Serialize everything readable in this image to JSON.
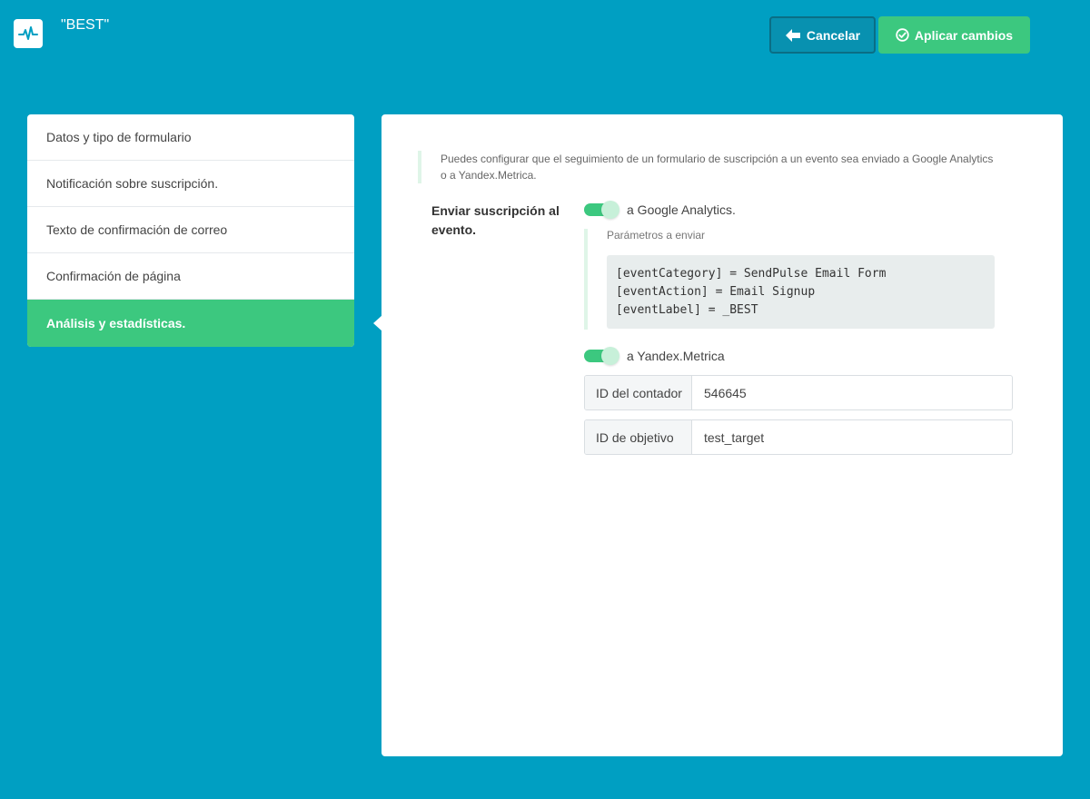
{
  "header": {
    "title": "\"BEST\"",
    "logo_icon": "pulse-icon",
    "cancel_label": "Cancelar",
    "apply_label": "Aplicar cambios"
  },
  "sidebar": {
    "items": [
      {
        "label": "Datos y tipo de formulario",
        "active": false
      },
      {
        "label": "Notificación sobre suscripción.",
        "active": false
      },
      {
        "label": "Texto de confirmación de correo",
        "active": false
      },
      {
        "label": "Confirmación de página",
        "active": false
      },
      {
        "label": "Análisis y estadísticas.",
        "active": true
      }
    ]
  },
  "main": {
    "note": "Puedes configurar que el seguimiento de un formulario de suscripción a un evento sea enviado a Google Analytics o a Yandex.Metrica.",
    "send_label": "Enviar suscripción al evento.",
    "google": {
      "label": "a Google Analytics.",
      "enabled": true,
      "params_title": "Parámetros a enviar",
      "params": [
        "[eventCategory] = SendPulse Email Form",
        "[eventAction] = Email Signup",
        "[eventLabel] = _BEST"
      ]
    },
    "yandex": {
      "label": "a Yandex.Metrica",
      "enabled": true,
      "counter_label": "ID del contador",
      "counter_value": "546645",
      "goal_label": "ID de objetivo",
      "goal_value": "test_target"
    }
  },
  "colors": {
    "background": "#009fc2",
    "accent": "#3cc87f",
    "cancel_bg": "#0891b0"
  }
}
